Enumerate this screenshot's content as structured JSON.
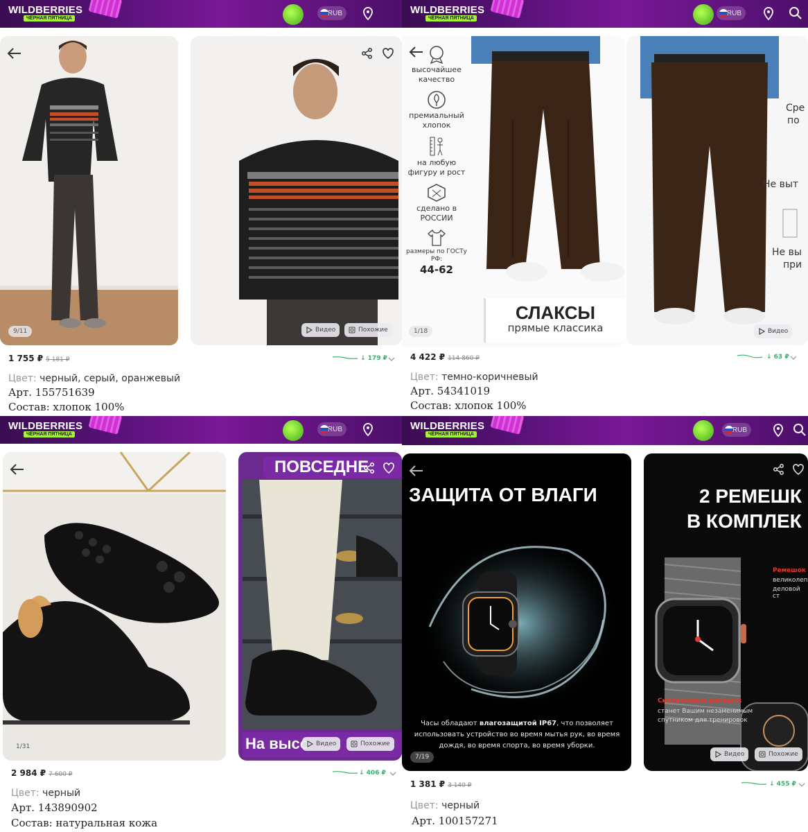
{
  "header": {
    "logo": "WILDBERRIES",
    "promo": "ЧЁРНАЯ ПЯТНИЦА",
    "currency": "RUB"
  },
  "products": [
    {
      "price": "1 755 ₽",
      "old_price": "5 181 ₽",
      "price_drop": "↓ 179 ₽",
      "color_label": "Цвет:",
      "color_value": "черный, серый, оранжевый",
      "article": "Арт. 155751639",
      "composition": "Состав: хлопок 100%",
      "gallery_position": "9/11",
      "video_label": "Видео",
      "similar_label": "Похожие"
    },
    {
      "price": "4 422 ₽",
      "old_price": "114 860 ₽",
      "price_drop": "↓ 63 ₽",
      "color_label": "Цвет:",
      "color_value": "темно-коричневый",
      "article": "Арт. 54341019",
      "composition": "Состав: хлопок 100%",
      "gallery_position": "1/18",
      "video_label": "Видео",
      "features": [
        "высочайшее качество",
        "премиальный хлопок",
        "на любую фигуру и рост",
        "сделано в РОССИИ",
        "размеры по ГОСТу РФ:"
      ],
      "sizes": "44-62",
      "banner_title": "СЛАКСЫ",
      "banner_subtitle": "прямые классика",
      "side_texts": [
        "Сре",
        "по",
        "Не выт",
        "Не вы",
        "при"
      ]
    },
    {
      "price": "2 984 ₽",
      "old_price": "7 600 ₽",
      "price_drop": "↓ 406 ₽",
      "color_label": "Цвет:",
      "color_value": "черный",
      "article": "Арт. 143890902",
      "composition": "Состав: натуральная кожа",
      "gallery_position": "1/31",
      "video_label": "Видео",
      "similar_label": "Похожие",
      "banner_top": "ПОВСЕДНЕ",
      "banner_bottom": "На высо"
    },
    {
      "price": "1 381 ₽",
      "old_price": "3 140 ₽",
      "price_drop": "↓ 455 ₽",
      "color_label": "Цвет:",
      "color_value": "черный",
      "article": "Арт. 100157271",
      "gallery_position": "7/19",
      "video_label": "Видео",
      "similar_label": "Похожие",
      "headline": "ЗАЩИТА ОТ ВЛАГИ",
      "desc_1": "Часы обладают",
      "desc_bold": "влагозащитой IP67",
      "desc_2": ", что позволяет использовать устройство во время мытья рук, во время дождя, во время спорта, во время уборки.",
      "second_headline_1": "2 РЕМЕШК",
      "second_headline_2": "В КОМПЛЕК",
      "strap_red": "Ремешок",
      "strap_text_1": "великолеп",
      "strap_text_2": "деловой ст",
      "silicone_title": "Силиконовый ремешок",
      "silicone_text": "станет Вашим незаменимым спутником для тренировок"
    }
  ],
  "colors": {
    "header_purple": "#5a127a",
    "promo_green": "#a6f43a",
    "drop_green": "#36b36a",
    "accent_red": "#e23b2e"
  }
}
